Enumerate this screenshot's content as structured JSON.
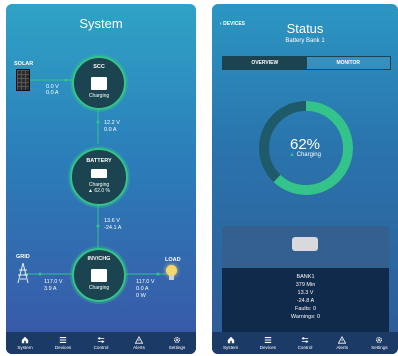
{
  "system": {
    "title": "System",
    "solar": {
      "label": "SOLAR",
      "voltage": "0.0 V",
      "current": "0.0 A"
    },
    "scc": {
      "label": "SCC",
      "state": "Charging"
    },
    "scc_battery": {
      "voltage": "12.2 V",
      "current": "0.0 A"
    },
    "battery": {
      "label": "BATTERY",
      "state": "Charging",
      "percent": "62.0 %"
    },
    "battery_inv": {
      "voltage": "13.6 V",
      "current": "-24.1 A"
    },
    "inv": {
      "label": "INV/CHG",
      "state": "Charging"
    },
    "grid": {
      "label": "GRID",
      "voltage": "117.0 V",
      "current": "3.9 A"
    },
    "load": {
      "label": "LOAD",
      "voltage": "117.0 V",
      "current": "0.0 A",
      "power": "0 W"
    }
  },
  "status": {
    "back_label": "DEVICES",
    "title": "Status",
    "subtitle": "Battery Bank 1",
    "tabs": [
      "OVERVIEW",
      "MONITOR"
    ],
    "gauge": {
      "value": "62%",
      "level": 0.62,
      "state": "Charging"
    },
    "details": {
      "name": "BANK1",
      "time": "379 Min",
      "voltage": "13.3 V",
      "current": "-24.8 A",
      "faults": "Faults: 0",
      "warnings": "Warnings: 0"
    }
  },
  "tabbar": [
    {
      "label": "System",
      "icon": "home-icon"
    },
    {
      "label": "Devices",
      "icon": "list-icon"
    },
    {
      "label": "Control",
      "icon": "sliders-icon"
    },
    {
      "label": "Alerts",
      "icon": "alert-icon"
    },
    {
      "label": "Settings",
      "icon": "gear-icon"
    }
  ],
  "colors": {
    "accent": "#34c38a",
    "node_bg": "#1c4450",
    "tabbar": "#1c3a66"
  }
}
